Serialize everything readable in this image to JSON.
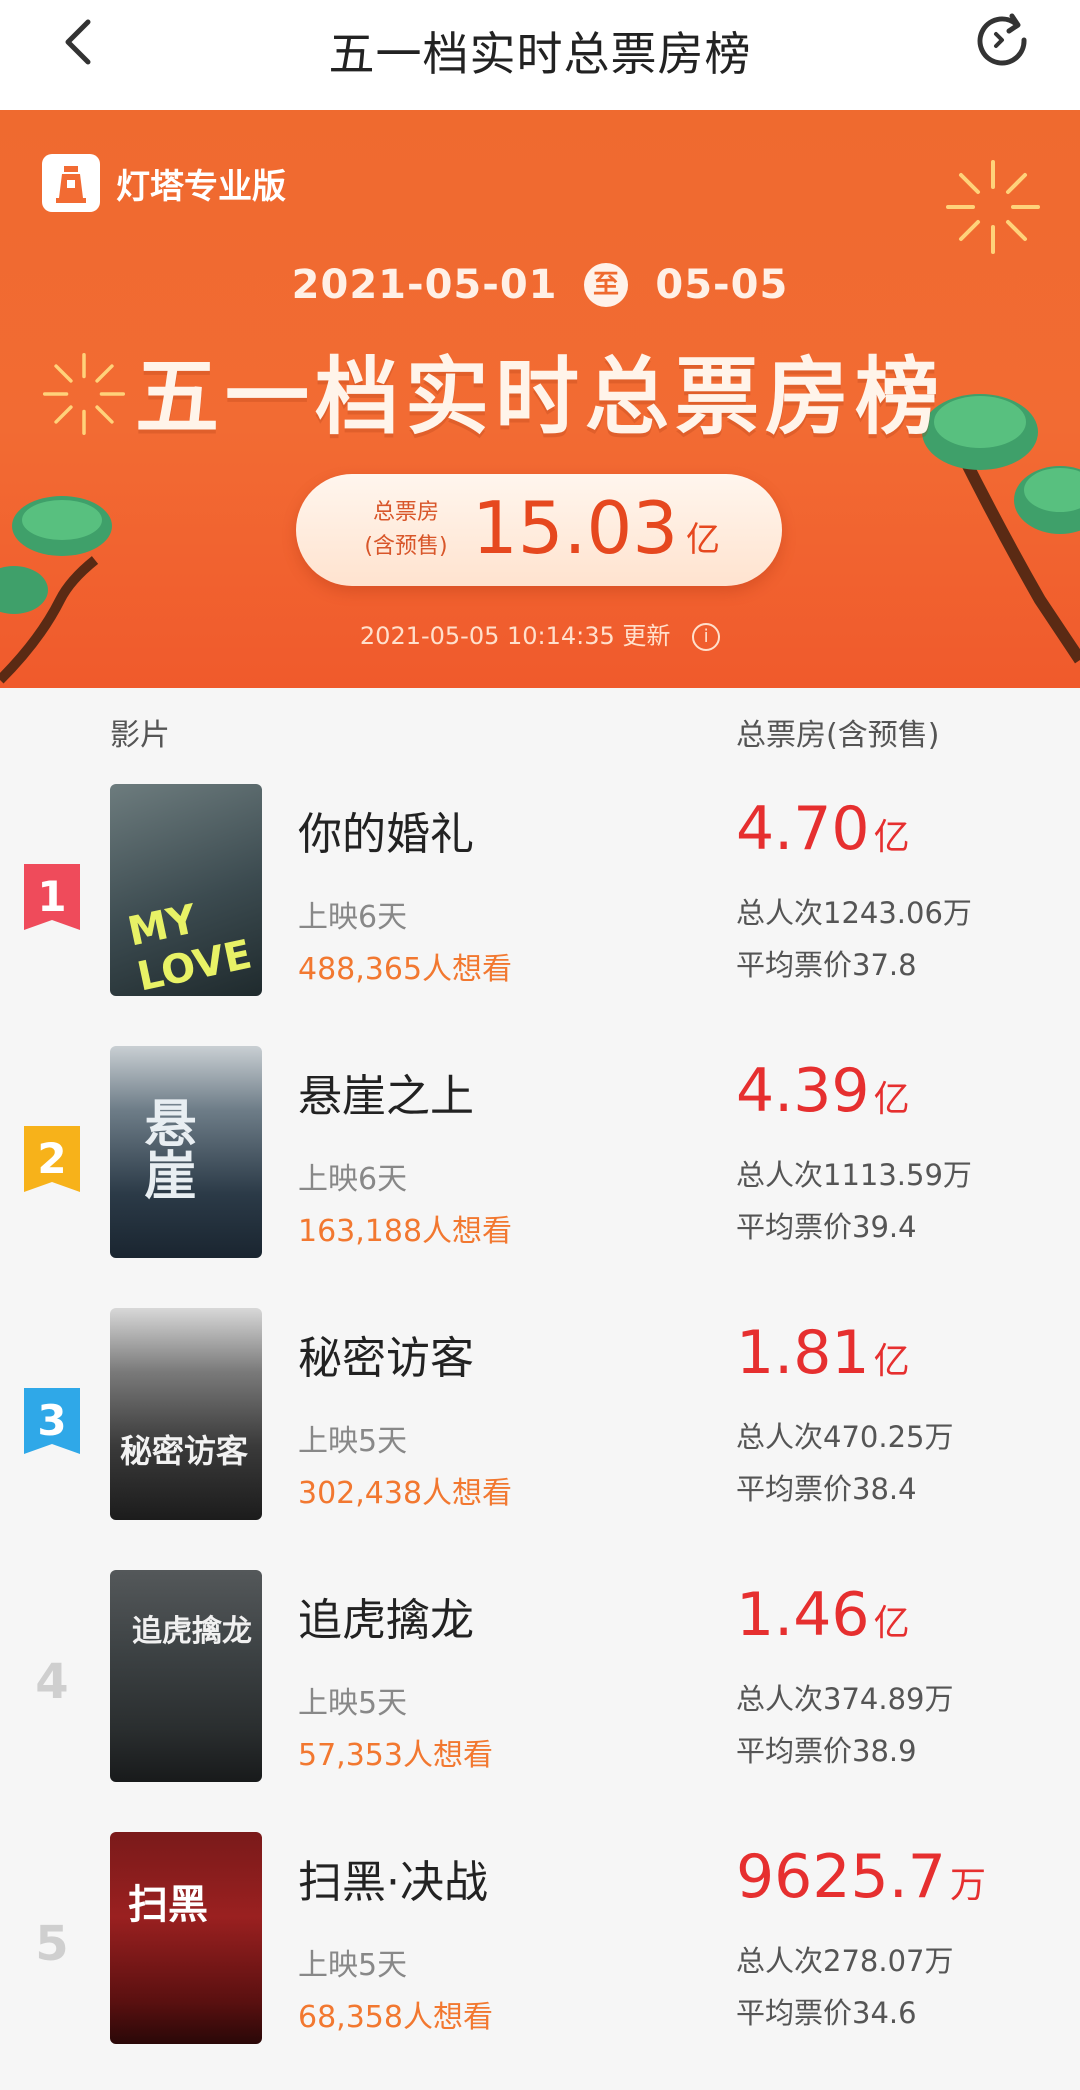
{
  "navbar": {
    "title": "五一档实时总票房榜",
    "back_icon": "chevron-left-icon",
    "refresh_icon": "refresh-icon"
  },
  "banner": {
    "brand": "灯塔专业版",
    "date_start": "2021-05-01",
    "date_sep": "至",
    "date_end": "05-05",
    "title": "五一档实时总票房榜",
    "total_label_1": "总票房",
    "total_label_2": "(含预售)",
    "total_value": "15.03",
    "total_unit": "亿",
    "update_time": "2021-05-05 10:14:35 更新",
    "info_icon": "info-icon"
  },
  "list_header": {
    "film": "影片",
    "total": "总票房(含预售)"
  },
  "colors": {
    "accent": "#ef6a2f",
    "box_red": "#e62f2f",
    "want_orange": "#f27830",
    "rank1": "#ef4b5b",
    "rank2": "#f7b21a",
    "rank3": "#2fa8e8"
  },
  "films": [
    {
      "rank": "1",
      "name": "你的婚礼",
      "days": "上映6天",
      "wants": "488,365人想看",
      "box": "4.70",
      "unit": "亿",
      "people": "总人次1243.06万",
      "price": "平均票价37.8"
    },
    {
      "rank": "2",
      "name": "悬崖之上",
      "days": "上映6天",
      "wants": "163,188人想看",
      "box": "4.39",
      "unit": "亿",
      "people": "总人次1113.59万",
      "price": "平均票价39.4"
    },
    {
      "rank": "3",
      "name": "秘密访客",
      "days": "上映5天",
      "wants": "302,438人想看",
      "box": "1.81",
      "unit": "亿",
      "people": "总人次470.25万",
      "price": "平均票价38.4"
    },
    {
      "rank": "4",
      "name": "追虎擒龙",
      "days": "上映5天",
      "wants": "57,353人想看",
      "box": "1.46",
      "unit": "亿",
      "people": "总人次374.89万",
      "price": "平均票价38.9"
    },
    {
      "rank": "5",
      "name": "扫黑·决战",
      "days": "上映5天",
      "wants": "68,358人想看",
      "box": "9625.7",
      "unit": "万",
      "people": "总人次278.07万",
      "price": "平均票价34.6"
    }
  ]
}
